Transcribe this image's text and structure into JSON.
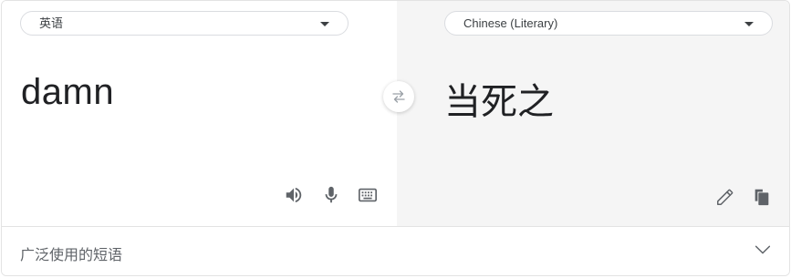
{
  "source": {
    "language": "英语",
    "text": "damn"
  },
  "target": {
    "language": "Chinese (Literary)",
    "text": "当死之"
  },
  "phrases": {
    "label": "广泛使用的短语"
  },
  "icons": {
    "swap": "swap-arrows-icon",
    "speaker": "speaker-icon",
    "mic": "microphone-icon",
    "keyboard": "keyboard-icon",
    "edit": "pencil-icon",
    "copy": "copy-icon",
    "expand": "chevron-down-icon"
  },
  "colors": {
    "icon": "#5f6368",
    "target_pane_bg": "#f5f5f5",
    "text": "#202124"
  }
}
